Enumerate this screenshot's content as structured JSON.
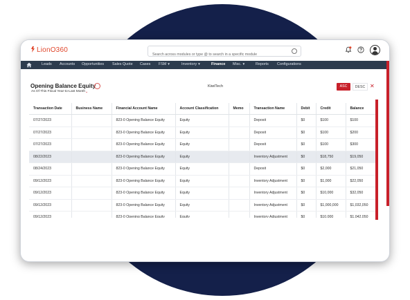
{
  "app": {
    "logo_text": "LionO360",
    "search_placeholder": "Search across modules or type @ to search in a specific module"
  },
  "nav": {
    "items": [
      "Leads",
      "Accounts",
      "Opportunities",
      "Sales Quote",
      "Cases",
      "FSM",
      "Inventory",
      "Finance",
      "Misc.",
      "Reports",
      "Configurations"
    ],
    "dropdowns": [
      "FSM",
      "Inventory",
      "Misc."
    ],
    "active": "Finance"
  },
  "report": {
    "title": "Opening Balance Equity",
    "period": "As Of This Fiscal Year-to-Last Month",
    "company": "KiwiTech",
    "asc_label": "ASC",
    "desc_label": "DESC",
    "close_symbol": "✕"
  },
  "table": {
    "columns": [
      "Transaction Date",
      "Business Name",
      "Financial Account Name",
      "Account Classification",
      "Memo",
      "Transaction Name",
      "Debit",
      "Credit",
      "Balance"
    ],
    "rows": [
      [
        "07/27/2023",
        "",
        "823-0 Opening Balance Equity",
        "Equity",
        "",
        "Deposit",
        "$0",
        "$100",
        "$100"
      ],
      [
        "07/27/2023",
        "",
        "823-0 Opening Balance Equity",
        "Equity",
        "",
        "Deposit",
        "$0",
        "$100",
        "$200"
      ],
      [
        "07/27/2023",
        "",
        "823-0 Opening Balance Equity",
        "Equity",
        "",
        "Deposit",
        "$0",
        "$100",
        "$300"
      ],
      [
        "08/22/2023",
        "",
        "823-0 Opening Balance Equity",
        "Equity",
        "",
        "Inventory Adjustment",
        "$0",
        "$18,750",
        "$19,050"
      ],
      [
        "08/24/2023",
        "",
        "823-0 Opening Balance Equity",
        "Equity",
        "",
        "Deposit",
        "$0",
        "$2,000",
        "$21,050"
      ],
      [
        "09/12/2023",
        "",
        "823-0 Opening Balance Equity",
        "Equity",
        "",
        "Inventory Adjustment",
        "$0",
        "$1,000",
        "$22,050"
      ],
      [
        "09/12/2023",
        "",
        "823-0 Opening Balance Equity",
        "Equity",
        "",
        "Inventory Adjustment",
        "$0",
        "$10,000",
        "$32,050"
      ],
      [
        "09/12/2023",
        "",
        "823-0 Opening Balance Equity",
        "Equity",
        "",
        "Inventory Adjustment",
        "$0",
        "$1,000,000",
        "$1,032,050"
      ],
      [
        "09/12/2023",
        "",
        "823-0 Opening Balance Equity",
        "Equity",
        "",
        "Inventory Adjustment",
        "$0",
        "$10,000",
        "$1,042,050"
      ]
    ],
    "highlighted_row": 3
  },
  "colors": {
    "brand": "#e0452a",
    "accent": "#c8202a",
    "nav_bg": "#2d3c4e",
    "backdrop_circle": "#14204a"
  },
  "icons": [
    "home-icon",
    "search-icon",
    "notification-icon",
    "help-icon",
    "user-avatar-icon",
    "filter-icon",
    "chevron-down-icon",
    "close-icon"
  ]
}
